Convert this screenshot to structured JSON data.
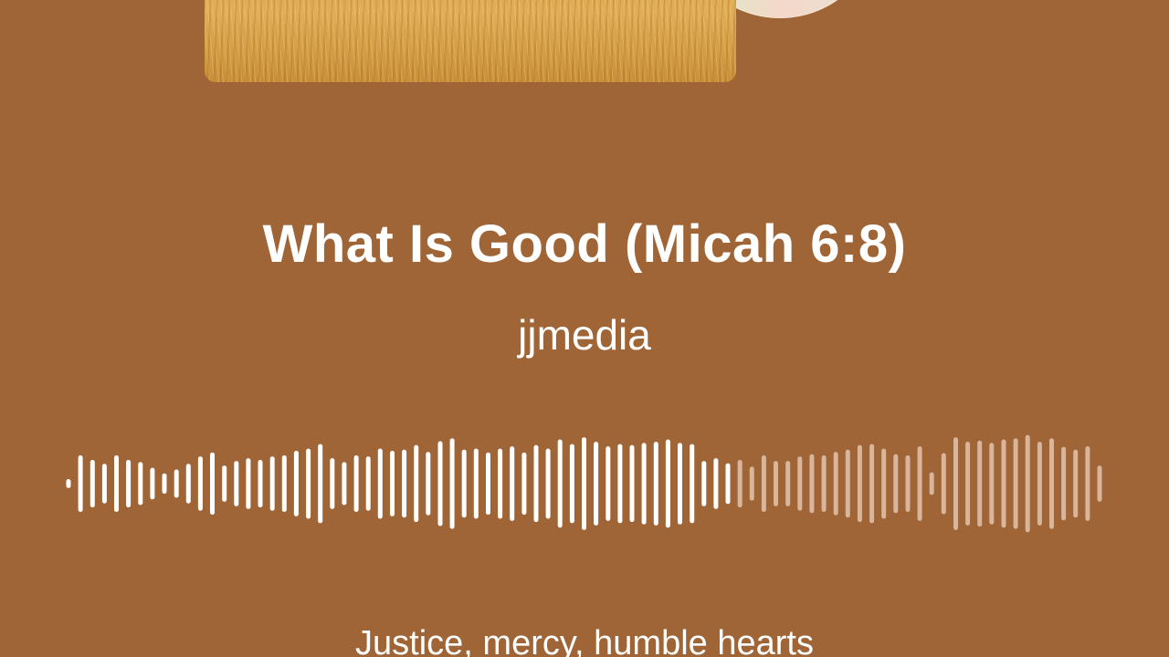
{
  "track": {
    "title": "What Is Good (Micah 6:8)",
    "artist": "jjmedia",
    "lyric_line": "Justice, mercy, humble hearts"
  },
  "album_art": {
    "icon": "wheat-field-cover-image",
    "disc_icon": "cd-disc-icon"
  },
  "playback": {
    "progress_fraction": 0.645
  },
  "waveform": {
    "bar_levels": [
      0.08,
      0.5,
      0.42,
      0.35,
      0.5,
      0.42,
      0.38,
      0.28,
      0.18,
      0.25,
      0.35,
      0.48,
      0.55,
      0.32,
      0.4,
      0.45,
      0.42,
      0.48,
      0.5,
      0.58,
      0.62,
      0.7,
      0.45,
      0.38,
      0.5,
      0.48,
      0.62,
      0.58,
      0.6,
      0.68,
      0.56,
      0.75,
      0.8,
      0.6,
      0.62,
      0.55,
      0.62,
      0.66,
      0.55,
      0.68,
      0.62,
      0.78,
      0.7,
      0.82,
      0.74,
      0.66,
      0.7,
      0.68,
      0.72,
      0.74,
      0.78,
      0.72,
      0.7,
      0.4,
      0.45,
      0.36,
      0.42,
      0.3,
      0.5,
      0.4,
      0.4,
      0.48,
      0.52,
      0.5,
      0.56,
      0.6,
      0.68,
      0.7,
      0.62,
      0.52,
      0.5,
      0.66,
      0.2,
      0.54,
      0.82,
      0.74,
      0.76,
      0.72,
      0.78,
      0.8,
      0.86,
      0.74,
      0.8,
      0.65,
      0.6,
      0.66,
      0.32
    ],
    "played_color": "#FFFFFF",
    "unplayed_color": "#D8B59B",
    "background_color": "#A06536"
  }
}
